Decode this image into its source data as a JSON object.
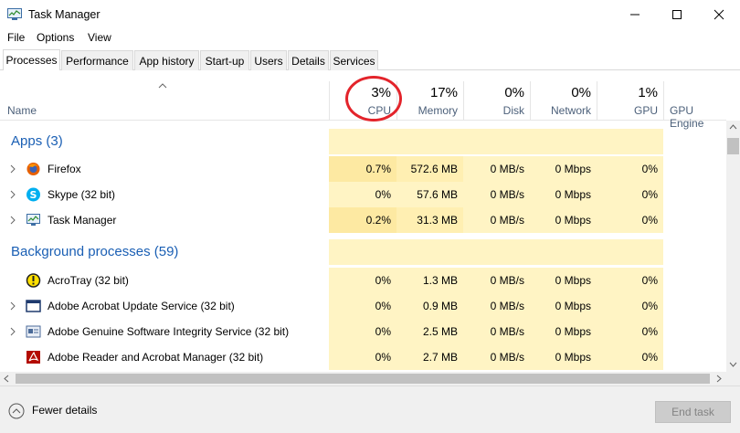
{
  "window": {
    "title": "Task Manager"
  },
  "menu": [
    "File",
    "Options",
    "View"
  ],
  "tabs": [
    "Processes",
    "Performance",
    "App history",
    "Start-up",
    "Users",
    "Details",
    "Services"
  ],
  "header": {
    "name_label": "Name",
    "columns": [
      {
        "pct": "3%",
        "label": "CPU"
      },
      {
        "pct": "17%",
        "label": "Memory"
      },
      {
        "pct": "0%",
        "label": "Disk"
      },
      {
        "pct": "0%",
        "label": "Network"
      },
      {
        "pct": "1%",
        "label": "GPU"
      }
    ],
    "extra_label": "GPU Engine"
  },
  "sections": {
    "apps": "Apps (3)",
    "background": "Background processes (59)"
  },
  "processes": [
    {
      "name": "Firefox",
      "cpu": "0.7%",
      "memory": "572.6 MB",
      "disk": "0 MB/s",
      "network": "0 Mbps",
      "gpu": "0%",
      "icon": "firefox-icon"
    },
    {
      "name": "Skype (32 bit)",
      "cpu": "0%",
      "memory": "57.6 MB",
      "disk": "0 MB/s",
      "network": "0 Mbps",
      "gpu": "0%",
      "icon": "skype-icon"
    },
    {
      "name": "Task Manager",
      "cpu": "0.2%",
      "memory": "31.3 MB",
      "disk": "0 MB/s",
      "network": "0 Mbps",
      "gpu": "0%",
      "icon": "task-manager-icon"
    },
    {
      "name": "AcroTray (32 bit)",
      "cpu": "0%",
      "memory": "1.3 MB",
      "disk": "0 MB/s",
      "network": "0 Mbps",
      "gpu": "0%",
      "icon": "acrotray-icon"
    },
    {
      "name": "Adobe Acrobat Update Service (32 bit)",
      "cpu": "0%",
      "memory": "0.9 MB",
      "disk": "0 MB/s",
      "network": "0 Mbps",
      "gpu": "0%",
      "icon": "service-window-icon"
    },
    {
      "name": "Adobe Genuine Software Integrity Service (32 bit)",
      "cpu": "0%",
      "memory": "2.5 MB",
      "disk": "0 MB/s",
      "network": "0 Mbps",
      "gpu": "0%",
      "icon": "service-window-icon"
    },
    {
      "name": "Adobe Reader and Acrobat Manager (32 bit)",
      "cpu": "0%",
      "memory": "2.7 MB",
      "disk": "0 MB/s",
      "network": "0 Mbps",
      "gpu": "0%",
      "icon": "acrobat-icon"
    }
  ],
  "footer": {
    "fewer_details": "Fewer details",
    "end_task": "End task"
  },
  "colors": {
    "section_title": "#1a5fb4",
    "highlight_circle": "#e3242b",
    "heat_light": "#fff4c4",
    "heat_mid": "#fde9a2"
  }
}
